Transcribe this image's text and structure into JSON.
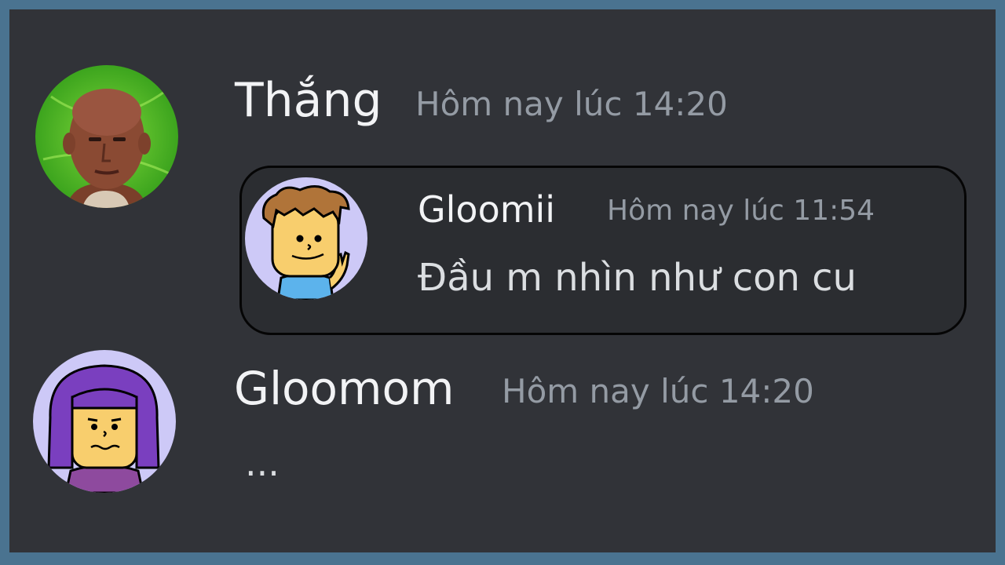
{
  "messages": [
    {
      "author": "Thắng",
      "timestamp": "Hôm nay lúc 14:20",
      "avatar_icon": "person-photo-avatar-icon",
      "quoted": {
        "author": "Gloomii",
        "timestamp": "Hôm nay lúc 11:54",
        "text": "Đầu m nhìn như con cu",
        "avatar_icon": "cartoon-boy-avatar-icon"
      }
    },
    {
      "author": "Gloomom",
      "timestamp": "Hôm nay lúc 14:20",
      "text": "...",
      "avatar_icon": "cartoon-girl-avatar-icon"
    }
  ],
  "colors": {
    "background": "#313338",
    "border": "#4a7390",
    "name": "#f2f3f5",
    "timestamp": "#949ba4",
    "message": "#dbdee1"
  }
}
